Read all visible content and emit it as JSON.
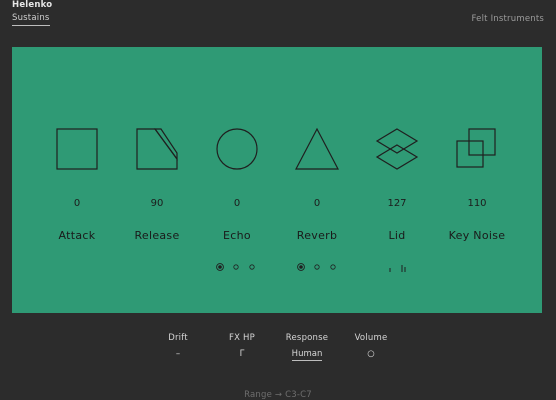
{
  "app": {
    "title": "Helenko",
    "tab": "Sustains",
    "brand": "Felt Instruments"
  },
  "panel": {
    "background": "#2f9a75",
    "controls": [
      {
        "label": "Attack",
        "value": "0",
        "icon": "square-icon"
      },
      {
        "label": "Release",
        "value": "90",
        "icon": "trapezoid-icon"
      },
      {
        "label": "Echo",
        "value": "0",
        "icon": "circle-icon"
      },
      {
        "label": "Reverb",
        "value": "0",
        "icon": "triangle-icon"
      },
      {
        "label": "Lid",
        "value": "127",
        "icon": "stacked-diamonds-icon"
      },
      {
        "label": "Key Noise",
        "value": "110",
        "icon": "overlapping-squares-icon"
      }
    ],
    "selectors": [
      {
        "name": "echo-mode",
        "options": 3,
        "selected": 1
      },
      {
        "name": "reverb-mode",
        "options": 3,
        "selected": 1
      }
    ],
    "lid_indicator": "ı Iı"
  },
  "bottom": {
    "drift": {
      "label": "Drift",
      "value": "–"
    },
    "fx_hp": {
      "label": "FX HP",
      "value": "Γ"
    },
    "response": {
      "label": "Response",
      "value": "Human"
    },
    "volume": {
      "label": "Volume",
      "value": "○"
    },
    "range": "Range → C3-C7"
  }
}
